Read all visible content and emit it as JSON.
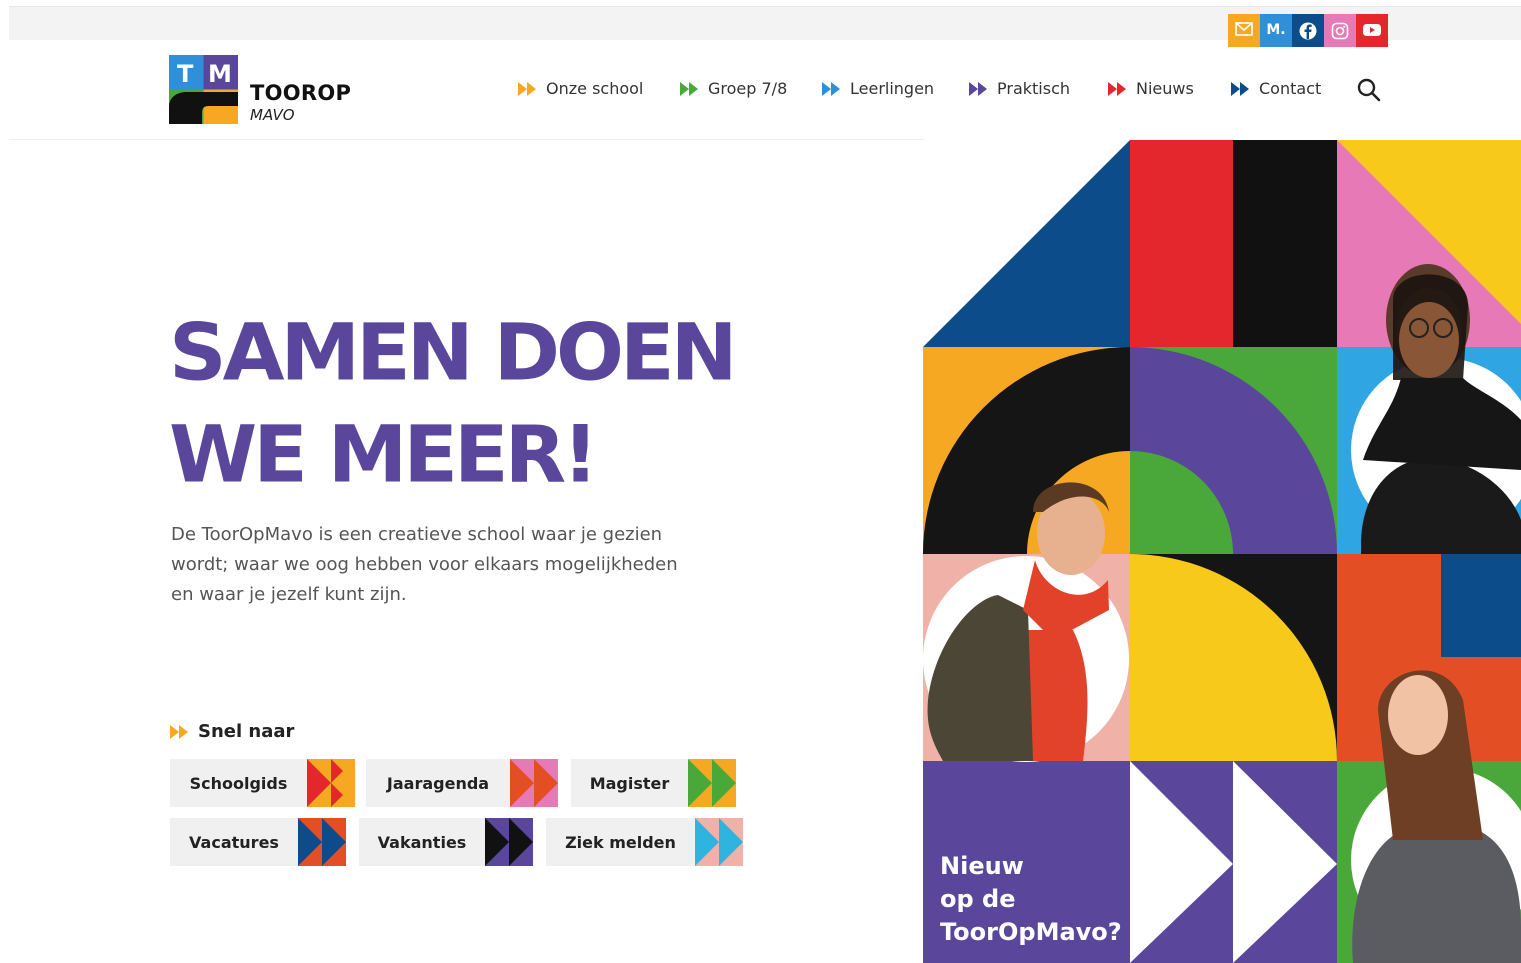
{
  "social": {
    "items": [
      {
        "name": "mail",
        "icon": "mail-icon",
        "color": "#f7a823"
      },
      {
        "name": "magister",
        "label": "M.",
        "color": "#2f8fd8"
      },
      {
        "name": "facebook",
        "icon": "facebook-icon",
        "color": "#0d4c8a"
      },
      {
        "name": "instagram",
        "icon": "instagram-icon",
        "color": "#e879b7"
      },
      {
        "name": "youtube",
        "icon": "youtube-icon",
        "color": "#e3272d"
      }
    ]
  },
  "logo": {
    "letters": [
      "T",
      "M"
    ],
    "name": "TOOROP",
    "sub": "MAVO"
  },
  "nav": {
    "items": [
      {
        "label": "Onze school",
        "color": "#f7a823"
      },
      {
        "label": "Groep 7/8",
        "color": "#4aa83a"
      },
      {
        "label": "Leerlingen",
        "color": "#2f8fd8"
      },
      {
        "label": "Praktisch",
        "color": "#5a479c"
      },
      {
        "label": "Nieuws",
        "color": "#e3272d"
      },
      {
        "label": "Contact",
        "color": "#0d4c8a"
      }
    ],
    "search_icon": "search-icon"
  },
  "hero": {
    "headline_line1": "SAMEN DOEN",
    "headline_line2": "WE MEER!",
    "intro": "De ToorOpMavo is een creatieve school waar je gezien wordt; waar we oog hebben voor elkaars mogelijkheden en waar je jezelf kunt zijn.",
    "intro_lines": [
      "De ToorOpMavo is een creatieve school waar je gezien",
      "wordt; waar we oog hebben voor elkaars mogelijkheden",
      "en waar je jezelf kunt zijn."
    ]
  },
  "quick": {
    "title": "Snel naar",
    "buttons": [
      {
        "label": "Schoolgids",
        "colors": [
          "#e3272d",
          "#f7a823"
        ]
      },
      {
        "label": "Jaaragenda",
        "colors": [
          "#e3272d",
          "#e879b7"
        ]
      },
      {
        "label": "Magister",
        "colors": [
          "#4aa83a",
          "#f7a823"
        ]
      },
      {
        "label": "Vacatures",
        "colors": [
          "#0d4c8a",
          "#e34e24"
        ]
      },
      {
        "label": "Vakanties",
        "colors": [
          "#5a479c",
          "#111111"
        ]
      },
      {
        "label": "Ziek melden",
        "colors": [
          "#2fb4e0",
          "#f0b2a8"
        ]
      }
    ]
  },
  "mosaic": {
    "caption_lines": [
      "Nieuw",
      "op de",
      "ToorOpMavo?"
    ]
  }
}
